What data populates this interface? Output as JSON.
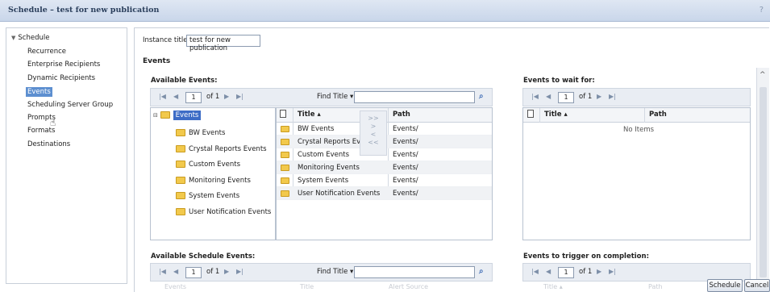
{
  "window": {
    "title": "Schedule – test for new publication",
    "help": "?"
  },
  "nav": {
    "root": "Schedule",
    "items": [
      "Recurrence",
      "Enterprise Recipients",
      "Dynamic Recipients",
      "Events",
      "Scheduling Server Group",
      "Prompts",
      "Formats",
      "Destinations"
    ],
    "selected": "Events"
  },
  "instance": {
    "label": "Instance title:",
    "value": "test for new publication"
  },
  "section_title": "Events",
  "available": {
    "title": "Available Events:",
    "pager": {
      "first": "⏮",
      "prev": "◀",
      "page": "1",
      "of": "of 1",
      "next": "▶",
      "last": "⏭"
    },
    "find_label": "Find Title",
    "find_arrow": "▾",
    "tree": {
      "root": "Events",
      "children": [
        "BW Events",
        "Crystal Reports Events",
        "Custom Events",
        "Monitoring Events",
        "System Events",
        "User Notification Events"
      ]
    },
    "grid": {
      "headers": {
        "title": "Title",
        "sort": "▴",
        "path": "Path"
      },
      "rows": [
        {
          "title": "BW Events",
          "path": "Events/"
        },
        {
          "title": "Crystal Reports Events",
          "path": "Events/"
        },
        {
          "title": "Custom Events",
          "path": "Events/"
        },
        {
          "title": "Monitoring Events",
          "path": "Events/"
        },
        {
          "title": "System Events",
          "path": "Events/"
        },
        {
          "title": "User Notification Events",
          "path": "Events/"
        }
      ]
    }
  },
  "move_buttons": {
    "add_all": ">>",
    "add": ">",
    "remove": "<",
    "remove_all": "<<"
  },
  "wait_for": {
    "title": "Events to wait for:",
    "pager": {
      "page": "1",
      "of": "of 1"
    },
    "headers": {
      "title": "Title",
      "sort": "▴",
      "path": "Path"
    },
    "empty": "No Items"
  },
  "schedule_events": {
    "title": "Available Schedule Events:",
    "pager": {
      "page": "1",
      "of": "of 1"
    },
    "find_label": "Find Title",
    "find_arrow": "▾",
    "faded_row": {
      "events": "Events",
      "title": "Title",
      "alert_source": "Alert Source"
    }
  },
  "trigger": {
    "title": "Events to trigger on completion:",
    "pager": {
      "page": "1",
      "of": "of 1"
    },
    "faded_row": {
      "title": "Title",
      "sort": "▴",
      "path": "Path"
    }
  },
  "buttons": {
    "schedule": "Schedule",
    "cancel": "Cancel"
  },
  "colors": {
    "titlebar": "#c9d6ea",
    "selection": "#3d6cc6",
    "folder": "#f2c94c"
  }
}
